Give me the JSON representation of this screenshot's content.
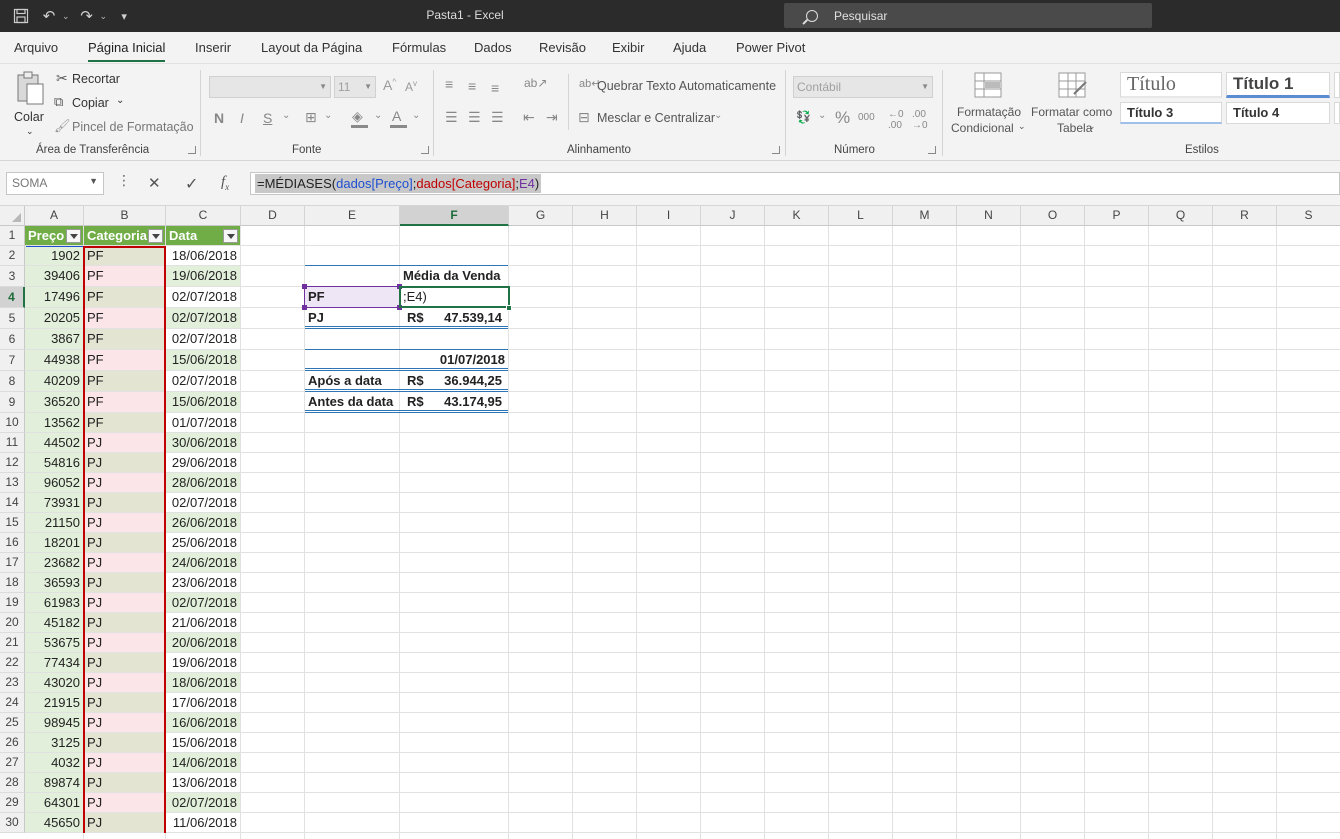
{
  "titlebar": {
    "doc_title": "Pasta1  -  Excel",
    "search_placeholder": "Pesquisar"
  },
  "tabs": [
    "Arquivo",
    "Página Inicial",
    "Inserir",
    "Layout da Página",
    "Fórmulas",
    "Dados",
    "Revisão",
    "Exibir",
    "Ajuda",
    "Power Pivot"
  ],
  "active_tab": "Página Inicial",
  "ribbon": {
    "clipboard": {
      "paste": "Colar",
      "cut": "Recortar",
      "copy": "Copiar",
      "format_painter": "Pincel de Formatação",
      "label": "Área de Transferência"
    },
    "font": {
      "font_size": "11",
      "label": "Fonte",
      "bold": "N",
      "italic": "I",
      "underline": "S"
    },
    "alignment": {
      "wrap": "Quebrar Texto Automaticamente",
      "merge": "Mesclar e Centralizar",
      "label": "Alinhamento"
    },
    "number": {
      "format": "Contábil",
      "label": "Número"
    },
    "styles": {
      "cond_format_1": "Formatação",
      "cond_format_2": "Condicional",
      "format_table_1": "Formatar como",
      "format_table_2": "Tabela",
      "label": "Estilos",
      "titulo": "Título",
      "titulo1": "Título 1",
      "titulo3": "Título 3",
      "titulo4": "Título 4"
    }
  },
  "formula_bar": {
    "name_box": "SOMA",
    "formula_parts": [
      {
        "text": "=MÉDIASES(",
        "color": "#222222"
      },
      {
        "text": "dados[Preço]",
        "color": "#1f4fd1"
      },
      {
        "text": ";",
        "color": "#222222"
      },
      {
        "text": "dados[Categoria]",
        "color": "#c00000"
      },
      {
        "text": ";",
        "color": "#222222"
      },
      {
        "text": "E4",
        "color": "#7030a0"
      },
      {
        "text": ")",
        "color": "#222222"
      }
    ]
  },
  "columns": [
    "A",
    "B",
    "C",
    "D",
    "E",
    "F",
    "G",
    "H",
    "I",
    "J",
    "K",
    "L",
    "M",
    "N",
    "O",
    "P",
    "Q",
    "R",
    "S"
  ],
  "selected_column": "F",
  "selected_row": 4,
  "table_headers": [
    "Preço",
    "Categoria",
    "Data"
  ],
  "table_rows": [
    [
      "1902",
      "PF",
      "18/06/2018"
    ],
    [
      "39406",
      "PF",
      "19/06/2018"
    ],
    [
      "17496",
      "PF",
      "02/07/2018"
    ],
    [
      "20205",
      "PF",
      "02/07/2018"
    ],
    [
      "3867",
      "PF",
      "02/07/2018"
    ],
    [
      "44938",
      "PF",
      "15/06/2018"
    ],
    [
      "40209",
      "PF",
      "02/07/2018"
    ],
    [
      "36520",
      "PF",
      "15/06/2018"
    ],
    [
      "13562",
      "PF",
      "01/07/2018"
    ],
    [
      "44502",
      "PJ",
      "30/06/2018"
    ],
    [
      "54816",
      "PJ",
      "29/06/2018"
    ],
    [
      "96052",
      "PJ",
      "28/06/2018"
    ],
    [
      "73931",
      "PJ",
      "02/07/2018"
    ],
    [
      "21150",
      "PJ",
      "26/06/2018"
    ],
    [
      "18201",
      "PJ",
      "25/06/2018"
    ],
    [
      "23682",
      "PJ",
      "24/06/2018"
    ],
    [
      "36593",
      "PJ",
      "23/06/2018"
    ],
    [
      "61983",
      "PJ",
      "02/07/2018"
    ],
    [
      "45182",
      "PJ",
      "21/06/2018"
    ],
    [
      "53675",
      "PJ",
      "20/06/2018"
    ],
    [
      "77434",
      "PJ",
      "19/06/2018"
    ],
    [
      "43020",
      "PJ",
      "18/06/2018"
    ],
    [
      "21915",
      "PJ",
      "17/06/2018"
    ],
    [
      "98945",
      "PJ",
      "16/06/2018"
    ],
    [
      "3125",
      "PJ",
      "15/06/2018"
    ],
    [
      "4032",
      "PJ",
      "14/06/2018"
    ],
    [
      "89874",
      "PJ",
      "13/06/2018"
    ],
    [
      "64301",
      "PJ",
      "02/07/2018"
    ],
    [
      "45650",
      "PJ",
      "11/06/2018"
    ]
  ],
  "summary": {
    "header": "Média da Venda",
    "pf_label": "PF",
    "pf_editing": ";E4)",
    "pj_label": "PJ",
    "pj_currency": "R$",
    "pj_value": "47.539,14",
    "date": "01/07/2018",
    "after_label": "Após a data",
    "after_currency": "R$",
    "after_value": "36.944,25",
    "before_label": "Antes da data",
    "before_currency": "R$",
    "before_value": "43.174,95"
  },
  "colors": {
    "table_header_green": "#70ad47",
    "col_a_fill": "#e2efda",
    "col_b_pink": "#fbe5e8",
    "col_b_olive": "#e4e4d2",
    "accent_green": "#217346",
    "range_red": "#c00000",
    "range_purple": "#7030a0"
  }
}
